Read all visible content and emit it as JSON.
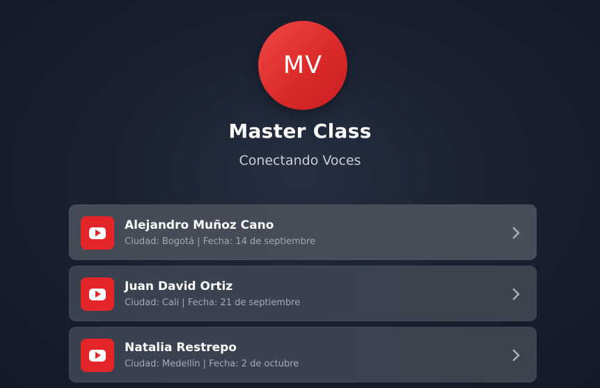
{
  "profile": {
    "initials": "MV",
    "title": "Master Class",
    "subtitle": "Conectando Voces"
  },
  "colors": {
    "accent_red": "#e4262a",
    "background": "#1a2231",
    "card": "#3a4250"
  },
  "items": [
    {
      "name": "Alejandro Muñoz Cano",
      "meta": "Ciudad: Bogotá | Fecha: 14 de septiembre",
      "icon": "youtube-icon"
    },
    {
      "name": "Juan David Ortiz",
      "meta": "Ciudad: Cali | Fecha: 21 de septiembre",
      "icon": "youtube-icon"
    },
    {
      "name": "Natalia Restrepo",
      "meta": "Ciudad: Medellín | Fecha: 2 de octubre",
      "icon": "youtube-icon"
    }
  ]
}
